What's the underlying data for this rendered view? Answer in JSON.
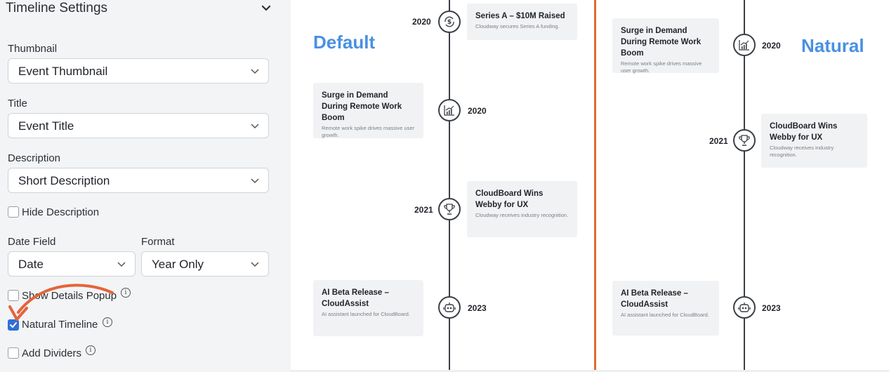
{
  "settings": {
    "panel_title": "Timeline Settings",
    "thumbnail_label": "Thumbnail",
    "thumbnail_value": "Event Thumbnail",
    "title_label": "Title",
    "title_value": "Event Title",
    "description_label": "Description",
    "description_value": "Short Description",
    "hide_description_label": "Hide Description",
    "hide_description_checked": false,
    "date_field_label": "Date Field",
    "date_field_value": "Date",
    "format_label": "Format",
    "format_value": "Year Only",
    "show_details_label": "Show Details Popup",
    "show_details_checked": false,
    "natural_timeline_label": "Natural Timeline",
    "natural_timeline_checked": true,
    "add_dividers_label": "Add Dividers",
    "add_dividers_checked": false,
    "info_glyph": "i"
  },
  "default_view": {
    "heading": "Default",
    "events": [
      {
        "year": "2020",
        "title": "Series A – $10M Raised",
        "desc": "Cloudway secures Series A funding.",
        "icon": "dollar-cycle-icon"
      },
      {
        "year": "2020",
        "title": "Surge in Demand During Remote Work Boom",
        "desc": "Remote work spike drives massive user growth.",
        "icon": "growth-chart-icon"
      },
      {
        "year": "2021",
        "title": "CloudBoard Wins Webby for UX",
        "desc": "Cloudway receives industry recognition.",
        "icon": "trophy-icon"
      },
      {
        "year": "2023",
        "title": "AI Beta Release – CloudAssist",
        "desc": "AI assistant launched for CloudBoard.",
        "icon": "robot-icon"
      }
    ]
  },
  "natural_view": {
    "heading": "Natural",
    "events": [
      {
        "year": "2020",
        "title": "Surge in Demand During Remote Work Boom",
        "desc": "Remote work spike drives massive user growth.",
        "icon": "growth-chart-icon"
      },
      {
        "year": "2021",
        "title": "CloudBoard Wins Webby for UX",
        "desc": "Cloudway receives industry recognition.",
        "icon": "trophy-icon"
      },
      {
        "year": "2023",
        "title": "AI Beta Release – CloudAssist",
        "desc": "AI assistant launched for CloudBoard.",
        "icon": "robot-icon"
      }
    ]
  },
  "colors": {
    "heading_blue": "#4a90e2",
    "divider_orange": "#e06a2f",
    "arrow_orange": "#e4643a",
    "checkbox_blue": "#2f6fd8"
  }
}
